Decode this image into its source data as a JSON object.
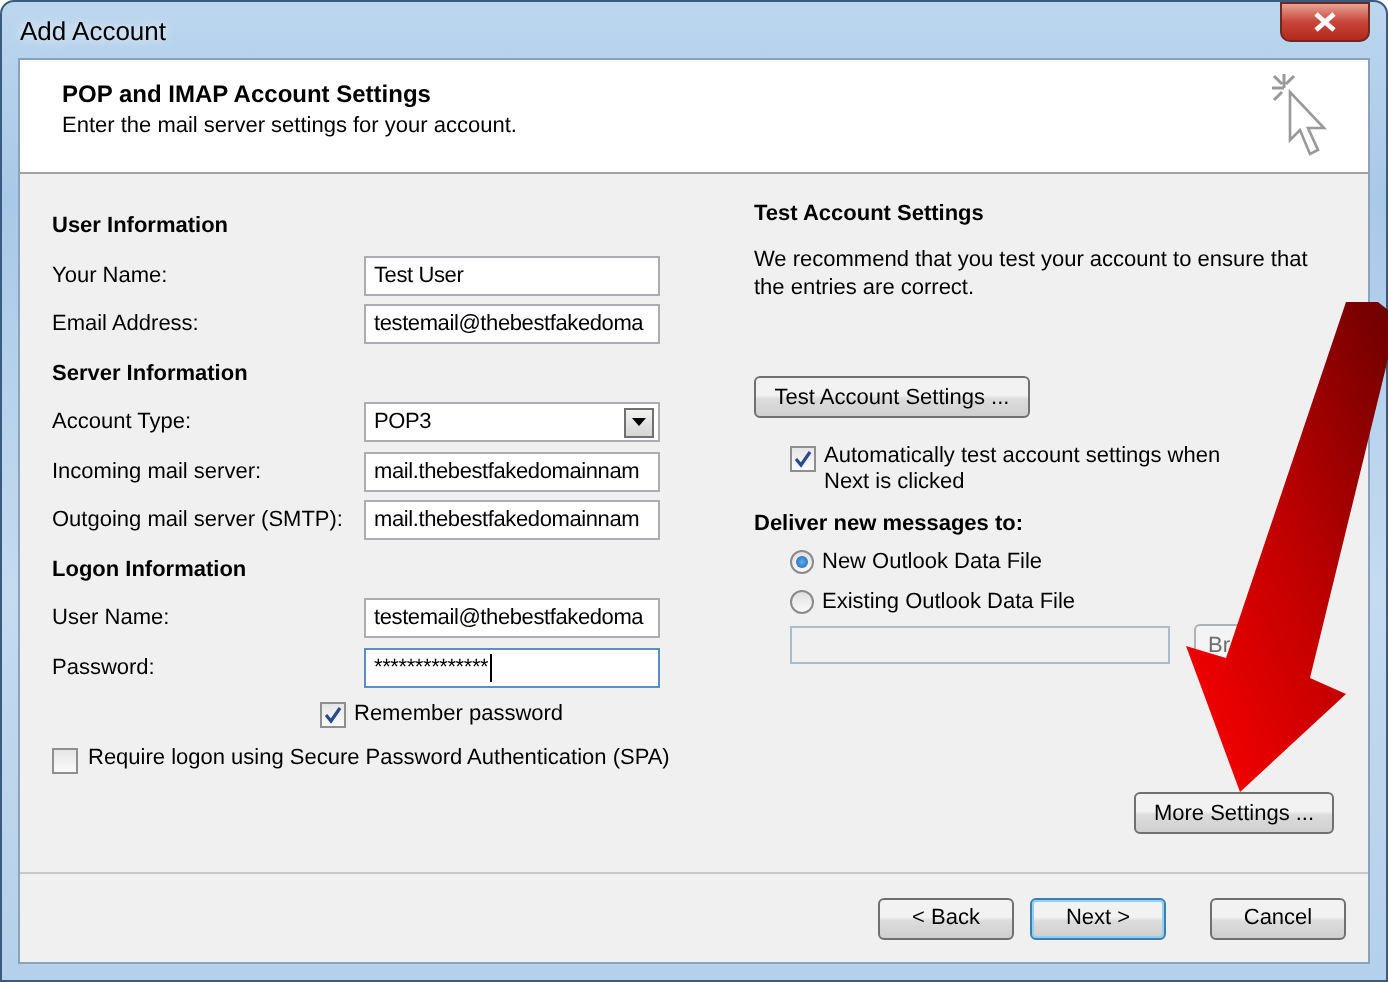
{
  "window": {
    "title": "Add Account"
  },
  "header": {
    "title": "POP and IMAP Account Settings",
    "subtitle": "Enter the mail server settings for your account."
  },
  "left": {
    "sections": [
      {
        "heading": "User Information",
        "fields": [
          {
            "label": "Your Name:",
            "value": "Test User",
            "kind": "text",
            "focused": false
          },
          {
            "label": "Email Address:",
            "value": "testemail@thebestfakedoma",
            "kind": "text",
            "focused": false
          }
        ]
      },
      {
        "heading": "Server Information",
        "fields": [
          {
            "label": "Account Type:",
            "value": "POP3",
            "kind": "dropdown",
            "focused": false
          },
          {
            "label": "Incoming mail server:",
            "value": "mail.thebestfakedomainnam",
            "kind": "text",
            "focused": false
          },
          {
            "label": "Outgoing mail server (SMTP):",
            "value": "mail.thebestfakedomainnam",
            "kind": "text",
            "focused": false
          }
        ]
      },
      {
        "heading": "Logon Information",
        "fields": [
          {
            "label": "User Name:",
            "value": "testemail@thebestfakedoma",
            "kind": "text",
            "focused": false
          },
          {
            "label": "Password:",
            "value": "**************",
            "kind": "text",
            "focused": true
          }
        ]
      }
    ],
    "remember_password": {
      "label": "Remember password",
      "checked": true
    },
    "spa": {
      "label": "Require logon using Secure Password Authentication (SPA)",
      "checked": false
    }
  },
  "right": {
    "heading": "Test Account Settings",
    "description": "We recommend that you test your account to ensure that the entries are correct.",
    "test_button": "Test Account Settings ...",
    "auto_test": {
      "label": "Automatically test account settings when Next is clicked",
      "checked": true
    },
    "deliver_heading": "Deliver new messages to:",
    "deliver_options": [
      {
        "label": "New Outlook Data File",
        "selected": true
      },
      {
        "label": "Existing Outlook Data File",
        "selected": false
      }
    ],
    "browse_button": "Br",
    "more_settings_button": "More Settings ..."
  },
  "buttons": [
    {
      "label": "< Back",
      "default": false
    },
    {
      "label": "Next >",
      "default": true
    },
    {
      "label": "Cancel",
      "default": false
    }
  ]
}
